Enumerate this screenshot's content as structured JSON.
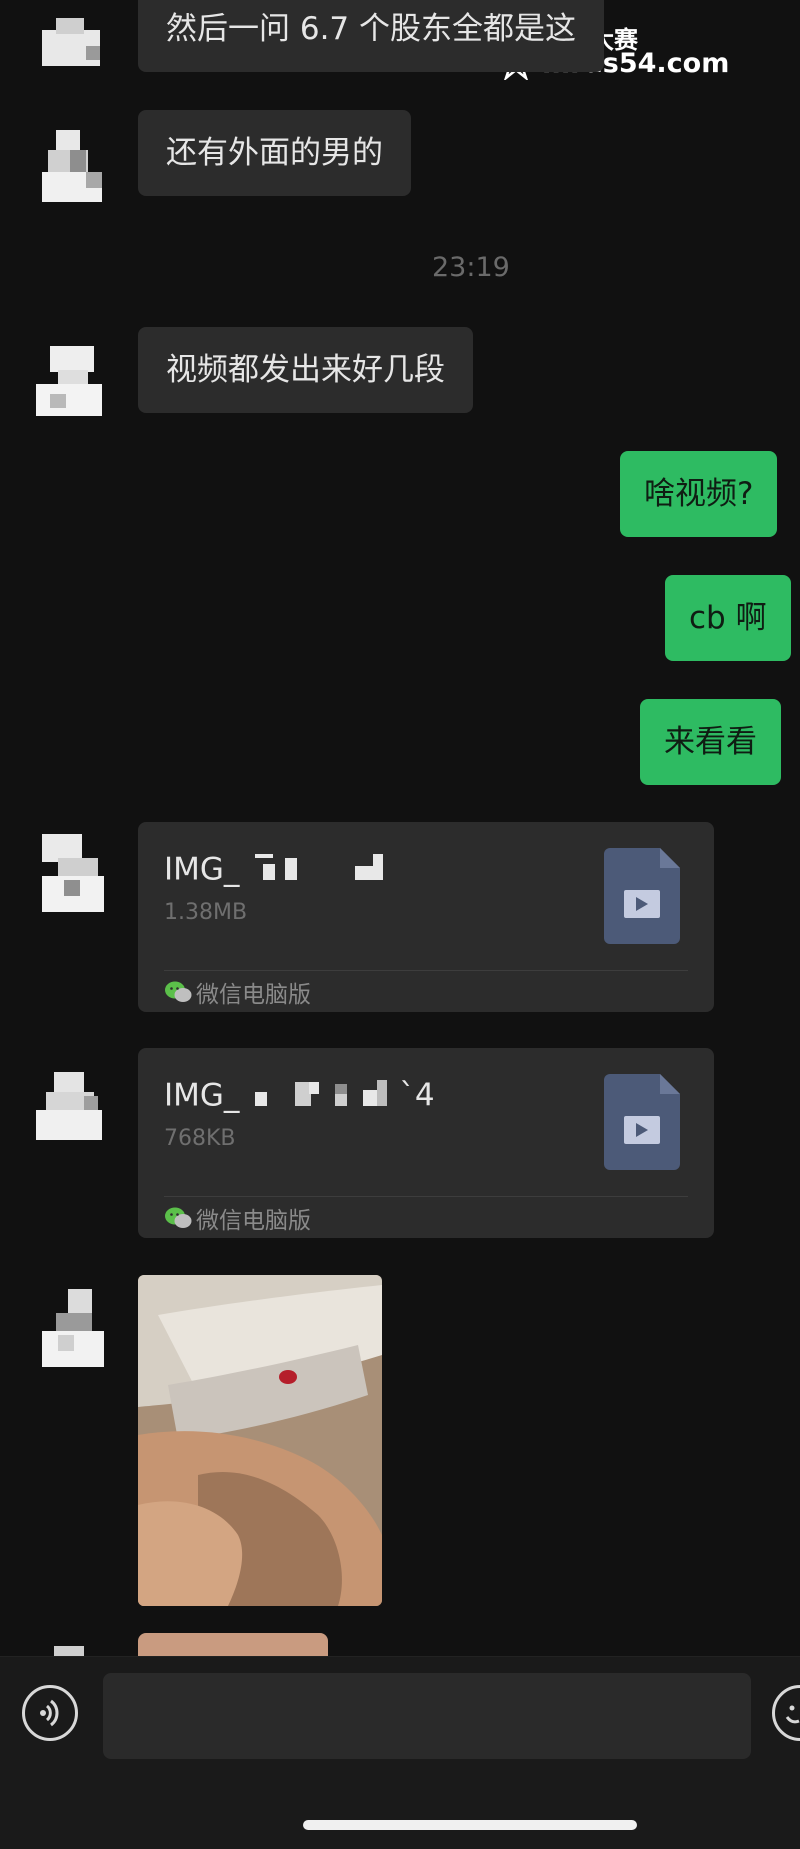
{
  "watermark": {
    "brand_cn": "每日大赛",
    "url": "mrds54.com"
  },
  "messages": {
    "top_partial": "然后一问 6.7 个股东全都是这",
    "m1": "还有外面的男的",
    "time": "23:19",
    "m2": "视频都发出来好几段",
    "out1": "啥视频?",
    "out2": "cb 啊",
    "out3": "来看看"
  },
  "files": [
    {
      "name_prefix": "IMG_",
      "name_suffix": "",
      "size": "1.38MB",
      "source": "微信电脑版",
      "icon": "video-file-icon"
    },
    {
      "name_prefix": "IMG_",
      "name_suffix": "`4",
      "size": "768KB",
      "source": "微信电脑版",
      "icon": "video-file-icon"
    }
  ],
  "icons": {
    "voice": "voice-icon",
    "emoji": "emoji-icon",
    "wechat": "wechat-logo-icon"
  },
  "colors": {
    "background": "#111111",
    "incoming_bubble": "#2c2c2c",
    "outgoing_bubble": "#2ebb62",
    "file_icon": "#4c5a78"
  }
}
